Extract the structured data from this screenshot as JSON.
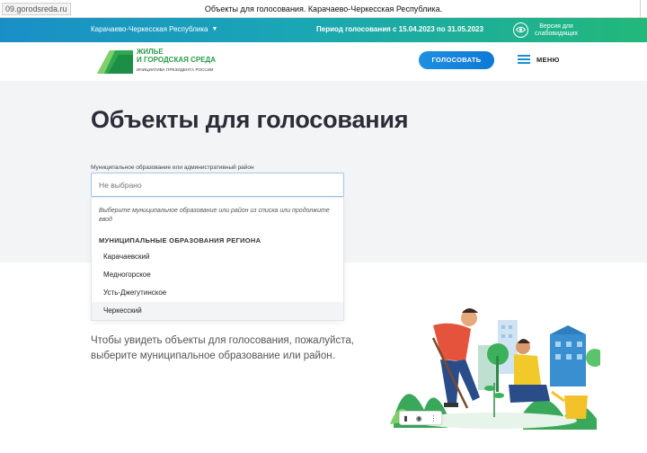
{
  "browser": {
    "url": "09.gorodsreda.ru",
    "tab_title": "Объекты для голосования. Карачаево-Черкесская Республика."
  },
  "topbar": {
    "region": "Карачаево-Черкесская Республика",
    "period": "Период голосования с 15.04.2023 по 31.05.2023",
    "vision_line1": "Версия для",
    "vision_line2": "слабовидящих",
    "colors": {
      "gradient_start": "#1a8fc7",
      "gradient_end": "#22b87a"
    }
  },
  "header": {
    "logo_line1": "ЖИЛЬЕ",
    "logo_line2": "И ГОРОДСКАЯ СРЕДА",
    "logo_line3": "ИНИЦИАТИВА ПРЕЗИДЕНТА РОССИИ",
    "vote_button": "ГОЛОСОВАТЬ",
    "menu_label": "МЕНЮ"
  },
  "main": {
    "title": "Объекты для голосования",
    "field_label": "Муниципальное образование или административный район",
    "select_placeholder": "Не выбрано",
    "dropdown": {
      "hint": "Выберите муниципальное образование или район из списка или продолжите ввод",
      "group_title": "МУНИЦИПАЛЬНЫЕ ОБРАЗОВАНИЯ РЕГИОНА",
      "options": [
        "Карачаевский",
        "Медногорское",
        "Усть-Джегутинское",
        "Черкесский"
      ]
    },
    "info_line1": "Чтобы увидеть объекты для голосования, пожалуйста,",
    "info_line2": "выберите муниципальное образование или район."
  },
  "colors": {
    "accent_blue": "#1a8fd0",
    "brand_green": "#2a9b4a",
    "grey_bg": "#f3f4f6"
  }
}
